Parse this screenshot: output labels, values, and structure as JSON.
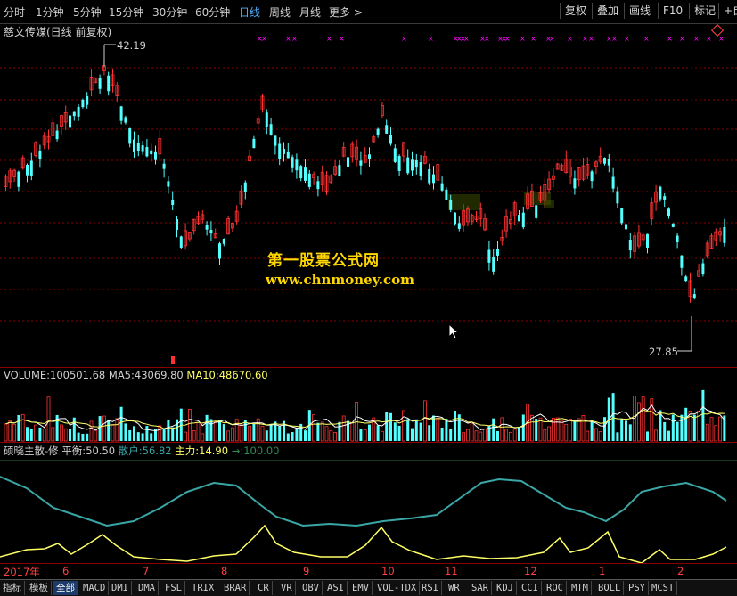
{
  "toolbar": {
    "timeframes": [
      "分时",
      "1分钟",
      "5分钟",
      "15分钟",
      "30分钟",
      "60分钟",
      "日线",
      "周线",
      "月线",
      "更多"
    ],
    "active_timeframe": "日线",
    "more_arrow": ">",
    "right_buttons": [
      "复权",
      "叠加",
      "画线",
      "F10",
      "标记",
      "+自"
    ]
  },
  "chart_title": "慈文传媒(日线 前复权)",
  "price_labels": {
    "high": "42.19",
    "low": "27.85"
  },
  "watermark": {
    "line1": "第一股票公式网",
    "line2": "www.chnmoney.com"
  },
  "volume_panel": {
    "label": "VOLUME:",
    "value": "100501.68",
    "ma5_label": "MA5:",
    "ma5": "43069.80",
    "ma10_label": "MA10:",
    "ma10": "48670.60"
  },
  "indicator_panel": {
    "name": "硕晓主散-修",
    "balance_label": "平衡:",
    "balance": "50.50",
    "retail_label": "散户:",
    "retail": "56.82",
    "main_label": "主力:",
    "main": "14.90",
    "ref_label": "→:",
    "ref": "100.00"
  },
  "date_axis": [
    "2017年",
    "6",
    "7",
    "8",
    "9",
    "10",
    "11",
    "12",
    "1",
    "2"
  ],
  "bottom_tabs": [
    "指标",
    "模板",
    "全部",
    "MACD",
    "DMI",
    "DMA",
    "FSL",
    "TRIX",
    "BRAR",
    "CR",
    "VR",
    "OBV",
    "ASI",
    "EMV",
    "VOL-TDX",
    "RSI",
    "WR",
    "SAR",
    "KDJ",
    "CCI",
    "ROC",
    "MTM",
    "BOLL",
    "PSY",
    "MCST"
  ],
  "active_tab": "全部",
  "colors": {
    "up": "#ff3232",
    "down": "#54ffff",
    "cyan_line": "#3aa6a6",
    "yellow_line": "#ffff66",
    "marker": "#ff00ff",
    "accent": "#4fb0ff"
  }
}
